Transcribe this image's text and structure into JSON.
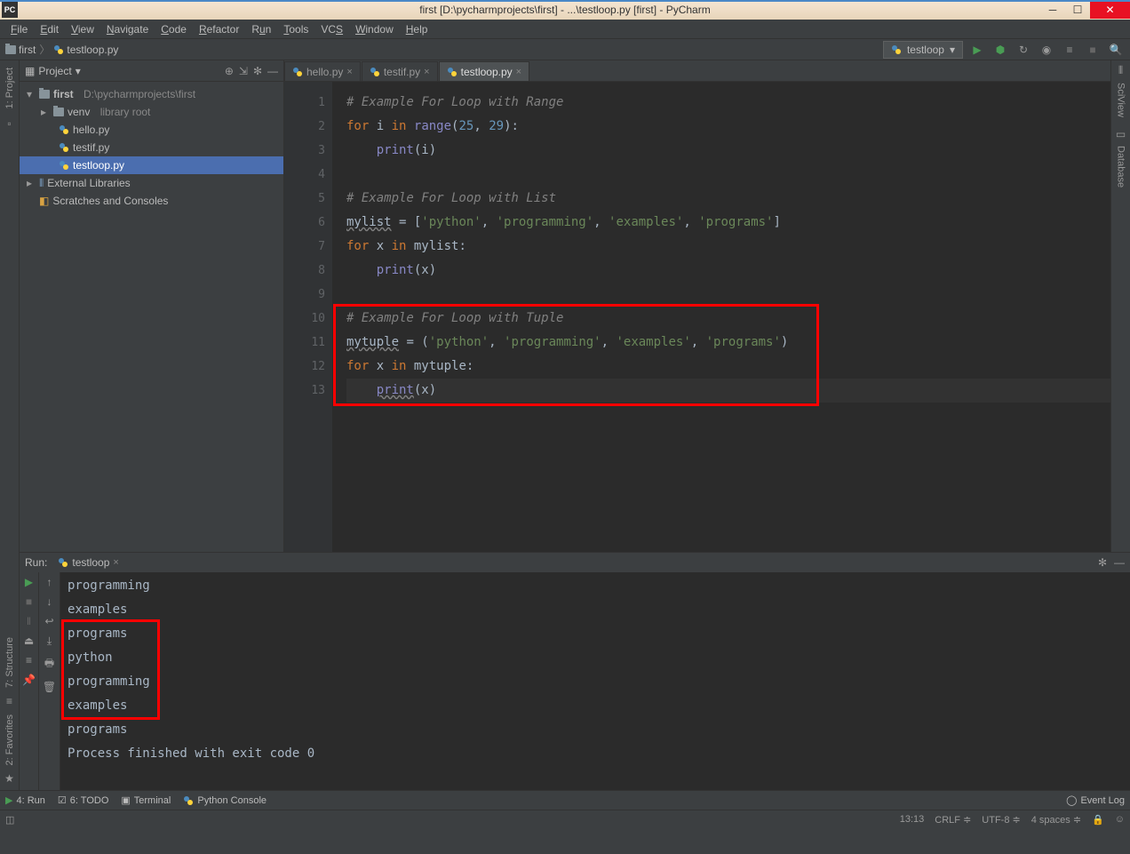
{
  "title": "first [D:\\pycharmprojects\\first] - ...\\testloop.py [first] - PyCharm",
  "menus": [
    "File",
    "Edit",
    "View",
    "Navigate",
    "Code",
    "Refactor",
    "Run",
    "Tools",
    "VCS",
    "Window",
    "Help"
  ],
  "breadcrumb": {
    "root": "first",
    "file": "testloop.py"
  },
  "run_config": "testloop",
  "project_panel": {
    "title": "Project",
    "root": "first",
    "root_path": "D:\\pycharmprojects\\first",
    "venv": "venv",
    "venv_label": "library root",
    "files": [
      "hello.py",
      "testif.py",
      "testloop.py"
    ],
    "external": "External Libraries",
    "scratches": "Scratches and Consoles"
  },
  "tabs": [
    {
      "name": "hello.py",
      "active": false
    },
    {
      "name": "testif.py",
      "active": false
    },
    {
      "name": "testloop.py",
      "active": true
    }
  ],
  "code": {
    "lines": [
      {
        "n": 1,
        "html": "<span class='comment'># Example For Loop with Range</span>"
      },
      {
        "n": 2,
        "html": "<span class='kw'>for</span> i <span class='kw'>in</span> <span class='builtin'>range</span>(<span class='num'>25</span>, <span class='num'>29</span>):"
      },
      {
        "n": 3,
        "html": "    <span class='builtin'>print</span>(i)"
      },
      {
        "n": 4,
        "html": ""
      },
      {
        "n": 5,
        "html": "<span class='comment'># Example For Loop with List</span>"
      },
      {
        "n": 6,
        "html": "<span class='wavy'>mylist</span> = [<span class='str'>'python'</span>, <span class='str'>'programming'</span>, <span class='str'>'examples'</span>, <span class='str'>'programs'</span>]"
      },
      {
        "n": 7,
        "html": "<span class='kw'>for</span> x <span class='kw'>in</span> mylist:"
      },
      {
        "n": 8,
        "html": "    <span class='builtin'>print</span>(x)"
      },
      {
        "n": 9,
        "html": ""
      },
      {
        "n": 10,
        "html": "<span class='comment'># Example For Loop with Tuple</span>"
      },
      {
        "n": 11,
        "html": "<span class='wavy'>mytuple</span> = (<span class='str'>'python'</span>, <span class='str'>'programming'</span>, <span class='str'>'examples'</span>, <span class='str'>'programs'</span>)"
      },
      {
        "n": 12,
        "html": "<span class='kw'>for</span> x <span class='kw'>in</span> mytuple:"
      },
      {
        "n": 13,
        "html": "    <span class='wavy builtin'>print</span>(x)",
        "current": true
      }
    ]
  },
  "console": {
    "label": "Run:",
    "tab": "testloop",
    "lines": [
      "programming",
      "examples",
      "programs",
      "python",
      "programming",
      "examples",
      "programs",
      "",
      "Process finished with exit code 0"
    ]
  },
  "bottom_tabs": {
    "run": "4: Run",
    "todo": "6: TODO",
    "terminal": "Terminal",
    "python_console": "Python Console",
    "event_log": "Event Log"
  },
  "status": {
    "pos": "13:13",
    "sep": "CRLF",
    "enc": "UTF-8",
    "indent": "4 spaces"
  },
  "side_rails": {
    "project": "1: Project",
    "structure": "7: Structure",
    "favorites": "2: Favorites",
    "sciview": "SciView",
    "database": "Database"
  }
}
